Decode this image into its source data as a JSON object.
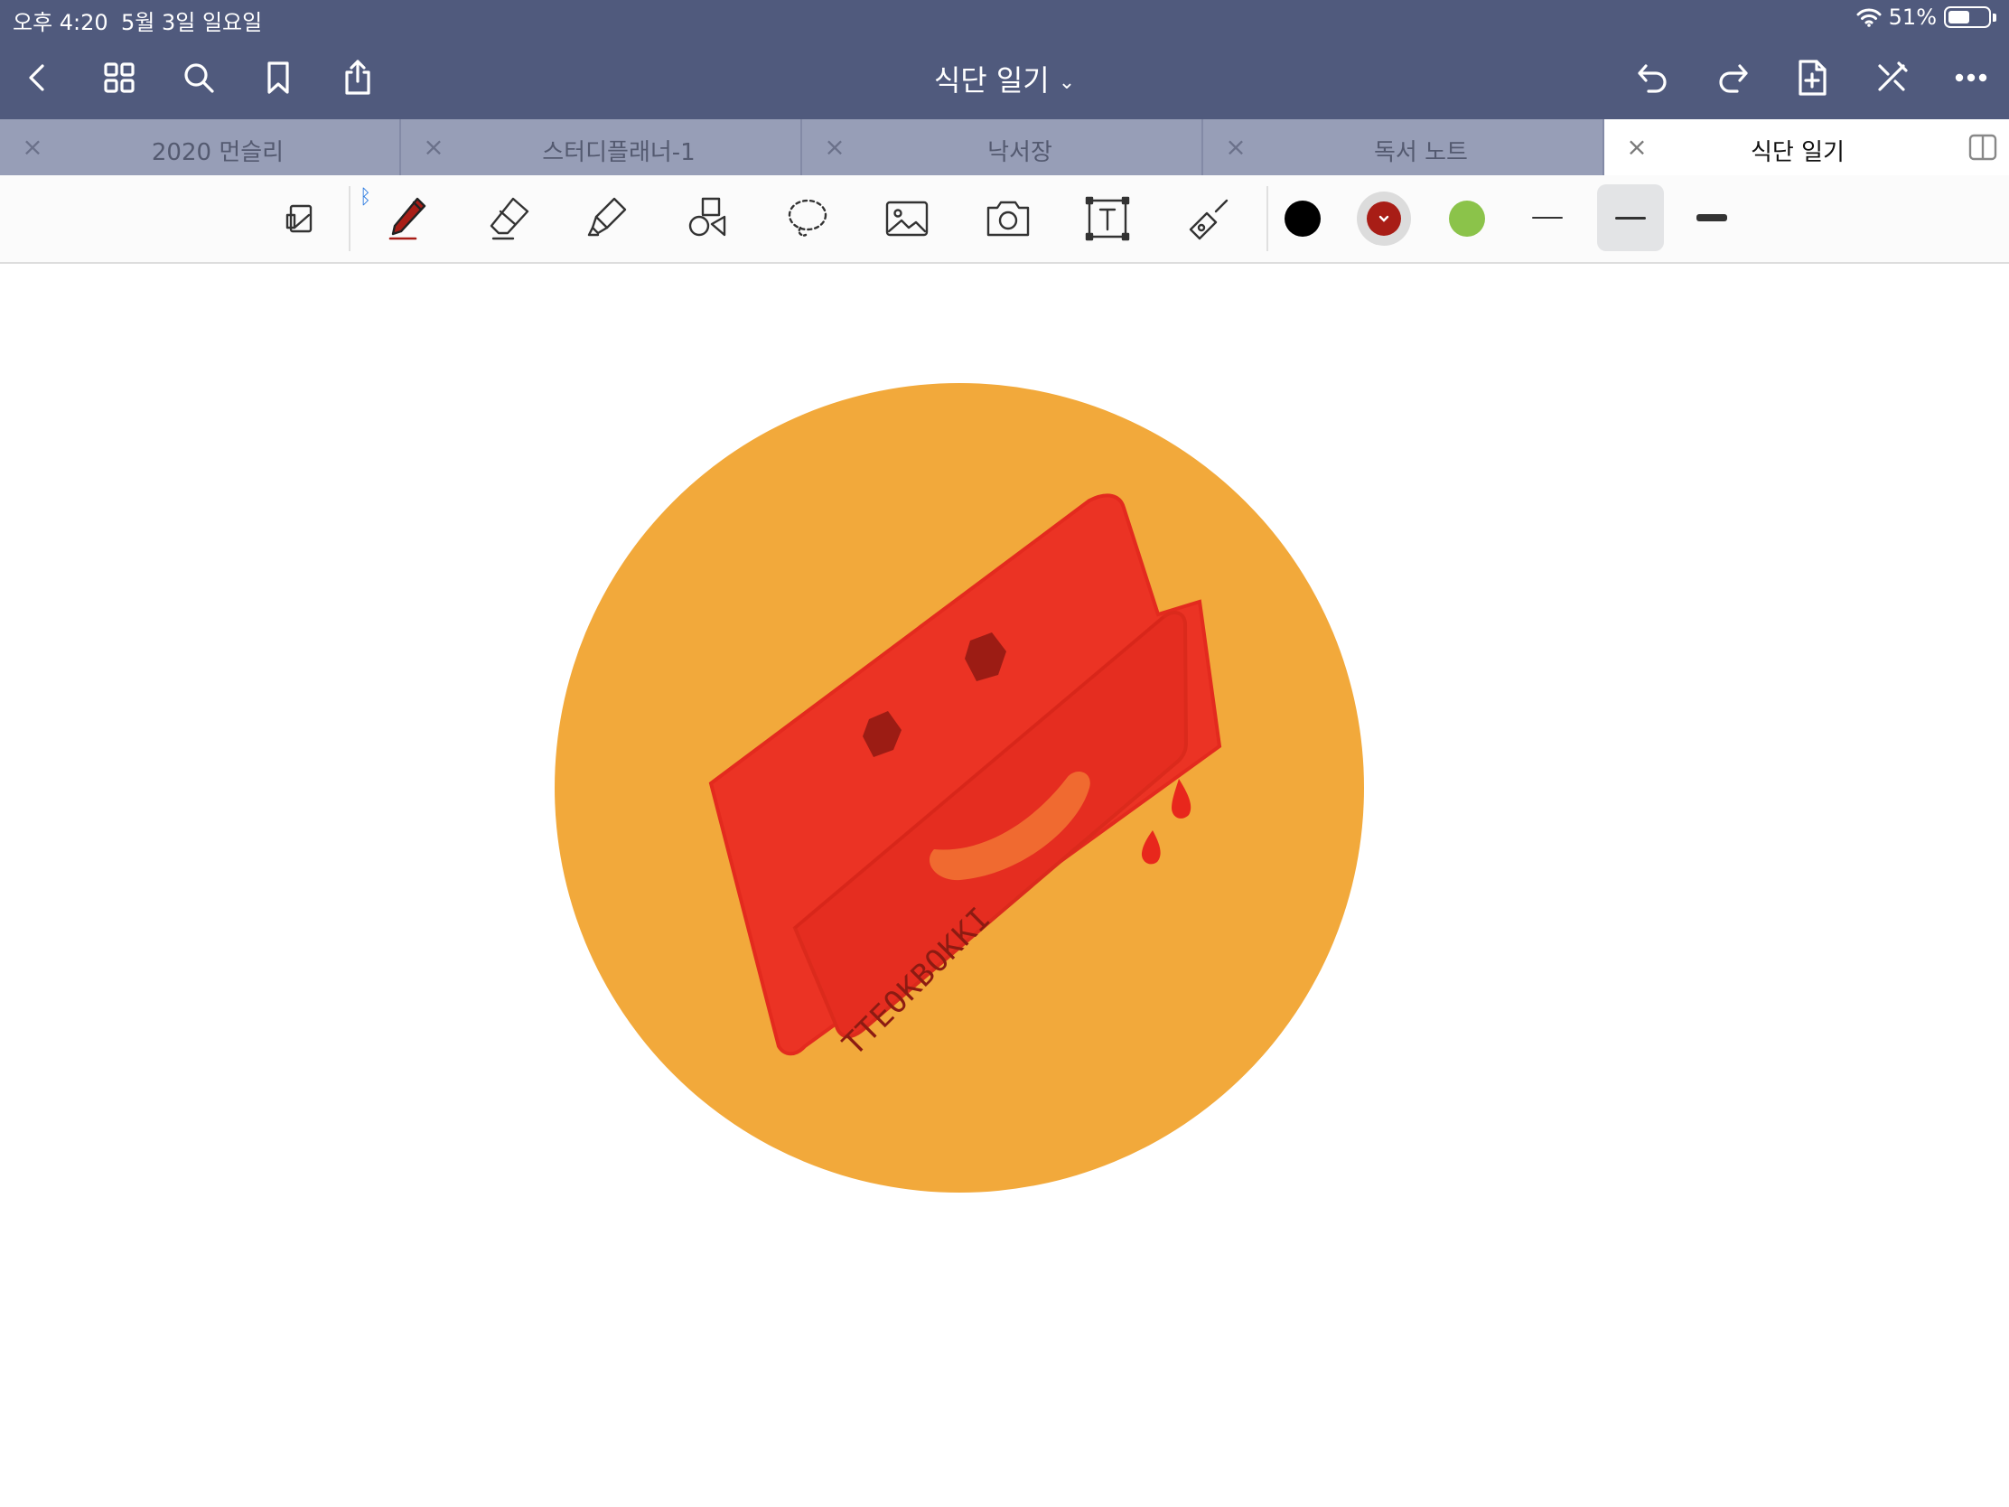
{
  "status_bar": {
    "time": "오후 4:20",
    "date": "5월 3일 일요일",
    "battery_percent": "51%",
    "battery_level": 0.51
  },
  "nav": {
    "title": "식단 일기",
    "title_chevron": "⌄",
    "left_icons": [
      "back-icon",
      "grid-icon",
      "search-icon",
      "bookmark-icon",
      "share-icon"
    ],
    "right_icons": [
      "undo-icon",
      "redo-icon",
      "add-page-icon",
      "close-pen-icon",
      "more-icon"
    ]
  },
  "tabs": [
    {
      "label": "2020 먼슬리",
      "active": false
    },
    {
      "label": "스터디플래너-1",
      "active": false
    },
    {
      "label": "낙서장",
      "active": false
    },
    {
      "label": "독서 노트",
      "active": false
    },
    {
      "label": "식단 일기",
      "active": true
    }
  ],
  "tab_close_glyph": "×",
  "toolbar": {
    "tools": [
      "page-view-icon",
      "pen-icon",
      "eraser-icon",
      "highlighter-icon",
      "shapes-icon",
      "lasso-icon",
      "image-icon",
      "camera-icon",
      "text-icon",
      "laser-pointer-icon"
    ],
    "selected_tool": "pen-icon",
    "bluetooth_glyph": "ᛒ",
    "colors": [
      "#000000",
      "#a81d16",
      "#8bc34a"
    ],
    "selected_color": "#a81d16",
    "widths": [
      "thin",
      "medium",
      "thick"
    ],
    "selected_width": "medium"
  },
  "canvas": {
    "drawing_text": "TTEOKBOKKI",
    "circle_color": "#f2a93b",
    "rice_cake_color": "#eb3324",
    "eye_color": "#9c1c14",
    "smile_color": "#f06a30",
    "drip_color": "#e8271c"
  }
}
